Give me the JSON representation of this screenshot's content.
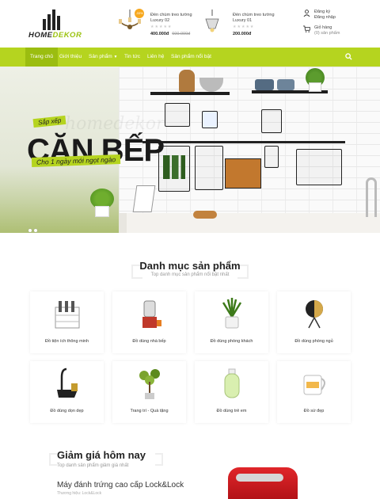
{
  "brand": {
    "name_a": "HOME",
    "name_b": "DEKOR"
  },
  "header": {
    "products": [
      {
        "name": "Đèn chùm treo tường Luxury 02",
        "price": "400.000đ",
        "old_price": "600.000đ",
        "badge": "-33%"
      },
      {
        "name": "Đèn chùm treo tường Luxury 01",
        "price": "200.000đ"
      }
    ],
    "account": {
      "register": "Đăng ký",
      "login": "Đăng nhập"
    },
    "cart": {
      "label": "Giỏ hàng",
      "count": "(0) sản phẩm"
    }
  },
  "nav": {
    "items": [
      "Trang chủ",
      "Giới thiệu",
      "Sản phẩm",
      "Tin tức",
      "Liên hệ",
      "Sản phẩm nổi bật"
    ]
  },
  "hero": {
    "tag": "Sắp xếp",
    "watermark": "homedekor",
    "title": "CĂN BẾP",
    "subtitle": "Cho 1 ngày mới ngọt ngào"
  },
  "categories": {
    "title": "Danh mục sản phẩm",
    "subtitle": "Top danh mục sản phẩm nổi bật nhất",
    "items": [
      "Đồ tiện ích thông minh",
      "Đồ dùng nhà bếp",
      "Đồ dùng phòng khách",
      "Đồ dùng phòng ngủ",
      "Đồ dùng dọn dẹp",
      "Trang trí - Quà tặng",
      "Đồ dùng trẻ em",
      "Đồ sứ đẹp"
    ]
  },
  "deals": {
    "title": "Giảm giá hôm nay",
    "subtitle": "Top danh sản phẩm giảm giá nhất",
    "product": "Máy đánh trứng cao cấp Lock&Lock",
    "meta": "Thương hiệu: Lock&Lock"
  },
  "colors": {
    "accent": "#b5d41f",
    "accent_dark": "#9bbd10"
  }
}
